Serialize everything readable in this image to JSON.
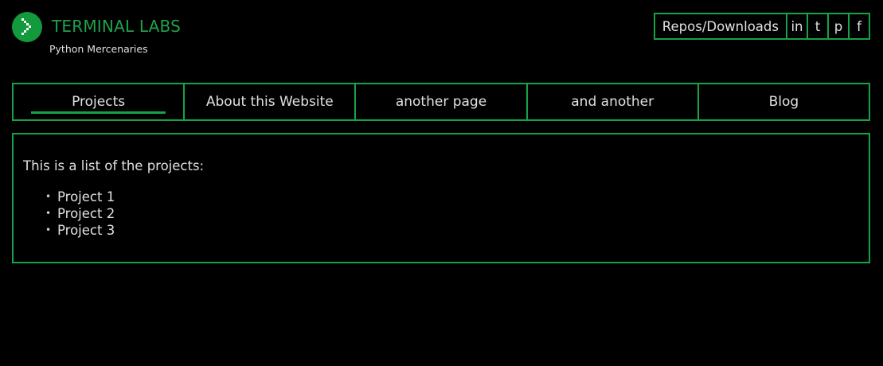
{
  "brand": {
    "title": "TERMINAL LABS",
    "subtitle": "Python Mercenaries",
    "logo_icon": "chevron-right-pixel-icon",
    "accent_color": "#16a347"
  },
  "toplinks": {
    "repos": "Repos/Downloads",
    "linkedin": "in",
    "twitter": "t",
    "pinterest": "p",
    "facebook": "f"
  },
  "nav": {
    "tabs": [
      {
        "label": "Projects",
        "active": true
      },
      {
        "label": "About this Website",
        "active": false
      },
      {
        "label": "another page",
        "active": false
      },
      {
        "label": "and another",
        "active": false
      },
      {
        "label": "Blog",
        "active": false
      }
    ]
  },
  "main": {
    "intro": "This is a list of the projects:",
    "projects": [
      "Project 1",
      "Project 2",
      "Project 3"
    ]
  }
}
